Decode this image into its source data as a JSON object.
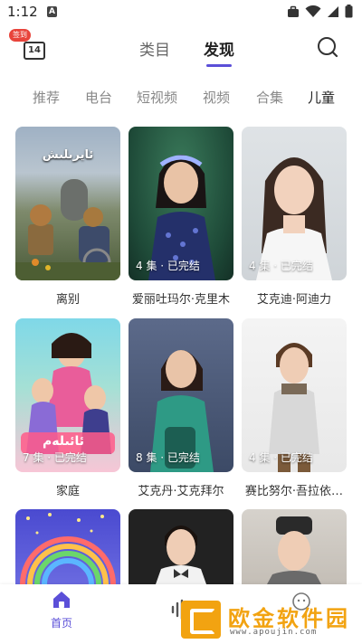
{
  "status_bar": {
    "time": "1:12",
    "notif_letter": "A"
  },
  "header": {
    "calendar_day": "14",
    "checkin_badge": "签到",
    "tabs": [
      {
        "label": "类目",
        "active": false
      },
      {
        "label": "发现",
        "active": true
      }
    ]
  },
  "categories": [
    {
      "label": "推荐",
      "active": false
    },
    {
      "label": "电台",
      "active": false
    },
    {
      "label": "短视频",
      "active": false
    },
    {
      "label": "视频",
      "active": false
    },
    {
      "label": "合集",
      "active": false
    },
    {
      "label": "儿童",
      "active": true
    }
  ],
  "cards": [
    {
      "title": "离别",
      "episodes": "",
      "poster_text": "ئايرىلىش"
    },
    {
      "title": "爱丽吐玛尔·克里木",
      "episodes": "4 集 · 已完结"
    },
    {
      "title": "艾克迪·阿迪力",
      "episodes": "4 集 · 已完结"
    },
    {
      "title": "家庭",
      "episodes": "7 集 · 已完结",
      "poster_text": "ئائىلەم"
    },
    {
      "title": "艾克丹·艾克拜尔",
      "episodes": "8 集 · 已完结"
    },
    {
      "title": "赛比努尔·吾拉依…",
      "episodes": "4 集 · 已完结"
    },
    {
      "title": "",
      "episodes": ""
    },
    {
      "title": "",
      "episodes": ""
    },
    {
      "title": "",
      "episodes": ""
    }
  ],
  "bottom_nav": {
    "home_label": "首页"
  },
  "watermark": {
    "brand": "欧金软件园",
    "url": "www.apoujin.com"
  },
  "colors": {
    "accent": "#5b4fd8",
    "badge": "#e8443b",
    "watermark": "#f2a311"
  }
}
